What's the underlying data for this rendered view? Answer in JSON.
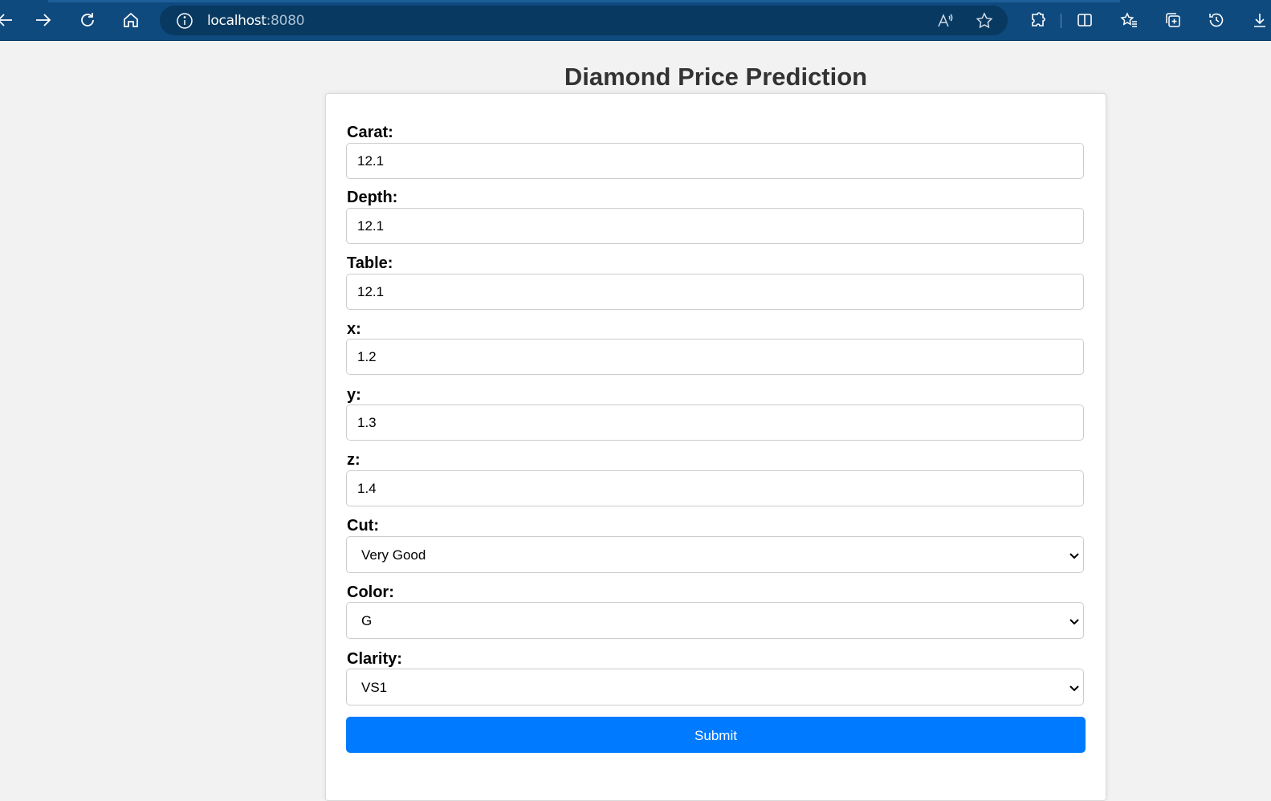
{
  "browser": {
    "url_host": "localhost",
    "url_port": ":8080",
    "icons": {
      "back": "back-arrow-icon",
      "forward": "forward-arrow-icon",
      "refresh": "refresh-icon",
      "home": "home-icon",
      "info": "info-icon",
      "read_aloud": "read-aloud-icon",
      "favorite": "star-icon",
      "extensions": "puzzle-icon",
      "split_screen": "split-screen-icon",
      "favorites": "favorites-icon",
      "collections": "collections-icon",
      "history": "history-icon",
      "downloads": "download-icon"
    },
    "colors": {
      "toolbar": "#0e4a7e",
      "address_bar": "#083960"
    }
  },
  "page": {
    "title": "Diamond Price Prediction",
    "fields": [
      {
        "label": "Carat:",
        "value": "12.1"
      },
      {
        "label": "Depth:",
        "value": "12.1"
      },
      {
        "label": "Table:",
        "value": "12.1"
      },
      {
        "label": "x:",
        "value": "1.2"
      },
      {
        "label": "y:",
        "value": "1.3"
      },
      {
        "label": "z:",
        "value": "1.4"
      }
    ],
    "selects": [
      {
        "label": "Cut:",
        "value": "Very Good"
      },
      {
        "label": "Color:",
        "value": "G"
      },
      {
        "label": "Clarity:",
        "value": "VS1"
      }
    ],
    "submit_label": "Submit",
    "colors": {
      "submit": "#007bff",
      "title": "#333333"
    }
  }
}
